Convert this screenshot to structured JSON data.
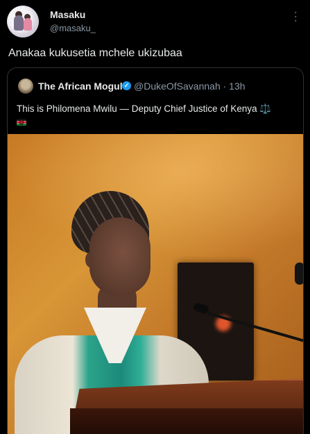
{
  "tweet": {
    "author_name": "Masaku",
    "author_handle": "@masaku_",
    "more_icon": "more-horizontal-icon",
    "text": "Anakaa kukusetia mchele ukizubaa"
  },
  "quoted": {
    "author_name": "The African Mogul",
    "verified_icon": "verified-badge-icon",
    "handle_time": "@DukeOfSavannah · 13h",
    "text": "This is Philomena Mwilu — Deputy Chief Justice of Kenya",
    "emoji_scales": "⚖️",
    "flag_icon": "kenya-flag-icon"
  },
  "colors": {
    "background": "#000000",
    "text_primary": "#e7e9ea",
    "text_secondary": "#8b98a5",
    "verified": "#1d9bf0",
    "border": "#2f3336"
  }
}
